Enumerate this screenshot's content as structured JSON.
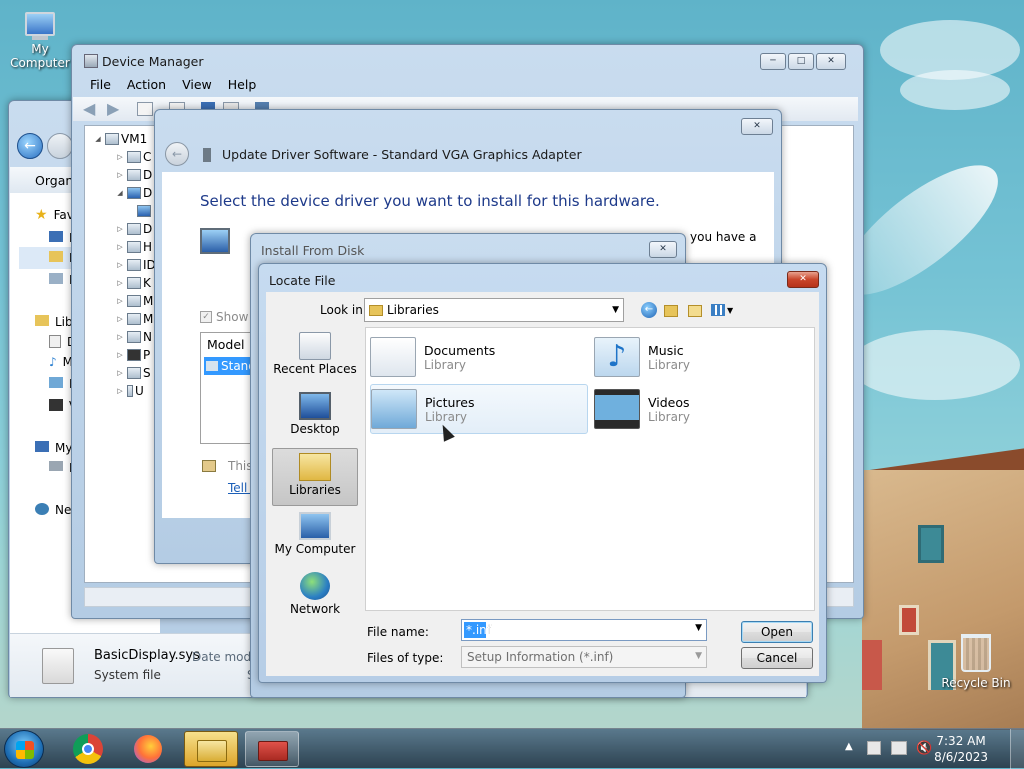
{
  "desktop": {
    "my_computer_label": "My Computer",
    "recycle_bin_label": "Recycle Bin"
  },
  "explorer_bg": {
    "organize_label": "Organi",
    "nav": [
      "Fav",
      "D",
      "D",
      "R",
      "Lib",
      "D",
      "M",
      "P",
      "V",
      "My",
      "L",
      "Ne"
    ],
    "file_name": "BasicDisplay.sys",
    "file_type": "System file",
    "date_label": "Date modifie",
    "size_label": "Si"
  },
  "device_manager": {
    "title": "Device Manager",
    "menu": [
      "File",
      "Action",
      "View",
      "Help"
    ],
    "root": "VM1",
    "tree_letters": [
      "C",
      "D",
      "D",
      "",
      "D",
      "H",
      "ID",
      "K",
      "M",
      "M",
      "N",
      "P",
      "S",
      "U"
    ]
  },
  "update_driver": {
    "title": "Update Driver Software - Standard VGA Graphics Adapter",
    "heading": "Select the device driver you want to install for this hardware.",
    "info_fragment": "you have a",
    "show_label": "Show",
    "model_header": "Model",
    "model_item": "Stand",
    "this_fragment": "This",
    "tell_fragment": "Tell m"
  },
  "install_from_disk": {
    "title": "Install From Disk"
  },
  "locate_file": {
    "title": "Locate File",
    "look_in_label": "Look in:",
    "look_in_value": "Libraries",
    "places": [
      {
        "label": "Recent Places"
      },
      {
        "label": "Desktop"
      },
      {
        "label": "Libraries"
      },
      {
        "label": "My Computer"
      },
      {
        "label": "Network"
      }
    ],
    "items": [
      {
        "name": "Documents",
        "sub": "Library"
      },
      {
        "name": "Music",
        "sub": "Library"
      },
      {
        "name": "Pictures",
        "sub": "Library"
      },
      {
        "name": "Videos",
        "sub": "Library"
      }
    ],
    "file_name_label": "File name:",
    "file_name_value": "*.inf",
    "files_of_type_label": "Files of type:",
    "files_of_type_value": "Setup Information (*.inf)",
    "open_label": "Open",
    "cancel_label": "Cancel"
  },
  "taskbar": {
    "time": "7:32 AM",
    "date": "8/6/2023"
  }
}
